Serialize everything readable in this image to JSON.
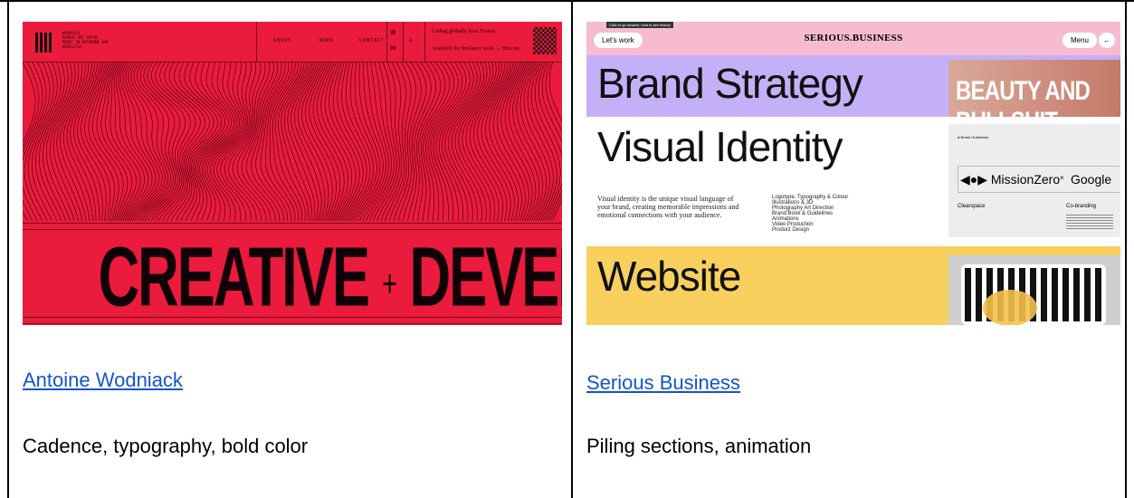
{
  "cards": [
    {
      "link_text": "Antoine Wodniack",
      "description": "Cadence, typography, bold color",
      "screenshot": {
        "address_lines": [
          "WODNIACK",
          "MIMEHT KKT SAPIN",
          "MIMET IN ARTOMANE NAM",
          "WEEKLAISA"
        ],
        "nav": [
          "ABOUT",
          "WORK",
          "CONTACT"
        ],
        "promo_line1": "Coding globally from France.",
        "promo_line2": "Available for freelance work → Hire me",
        "headline_left": "CREATIVE",
        "headline_plus": "+",
        "headline_right": "DEVELOPER",
        "bg_color": "#ea1b3c"
      }
    },
    {
      "link_text": "Serious Business",
      "description": "Piling sections, animation",
      "screenshot": {
        "tooltip": "Click to go forward, hold to see history",
        "left_button": "Let's work",
        "site_title": "SERIOUS.BUSINESS",
        "menu_button": "Menu",
        "sections": [
          {
            "title": "Brand Strategy",
            "color": "#c4b0f7",
            "thumb_text_1": "BEAUTY AND",
            "thumb_text_2": "BULLSHIT"
          },
          {
            "title": "Visual Identity",
            "color": "#ffffff",
            "paragraph": "Visual identity is the unique visual language of your brand, creating memorable impressions and emotional connections with your audience.",
            "services": [
              "Logotype, Typography & Colour",
              "Illustrations & 3D",
              "Photography Art Direction",
              "Brand Book & Guidelines",
              "Animations",
              "Video Production",
              "Product Design"
            ],
            "thumb_label": "Brand Guidelines",
            "thumb_brand_1": "MissionZero",
            "thumb_x": "×",
            "thumb_brand_2": "Google",
            "thumb_caption_1": "Clearspace",
            "thumb_caption_2": "Co-branding"
          },
          {
            "title": "Website",
            "color": "#f7d05e"
          }
        ]
      }
    }
  ]
}
